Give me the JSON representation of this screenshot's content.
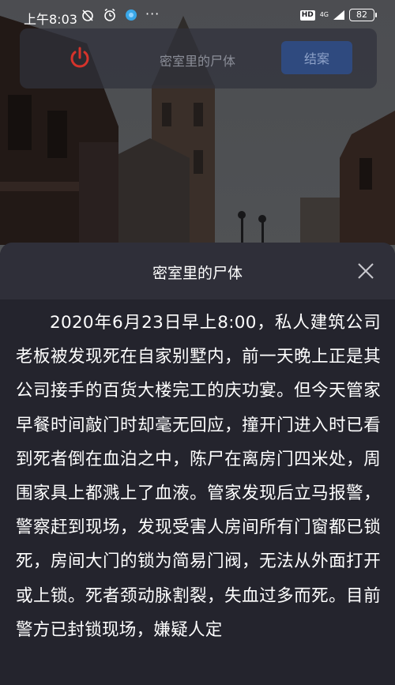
{
  "status_bar": {
    "time": "上午8:03",
    "hd": "HD",
    "network": "4G",
    "battery": "82"
  },
  "top_bar": {
    "title": "密室里的尸体",
    "close_case_label": "结案"
  },
  "sheet": {
    "title": "密室里的尸体",
    "story": "2020年6月23日早上8:00，私人建筑公司老板被发现死在自家别墅内，前一天晚上正是其公司接手的百货大楼完工的庆功宴。但今天管家早餐时间敲门时却毫无回应，撞开门进入时已看到死者倒在血泊之中，陈尸在离房门四米处，周围家具上都溅上了血液。管家发现后立马报警，警察赶到现场，发现受害人房间所有门窗都已锁死，房间大门的锁为简易门阀，无法从外面打开或上锁。死者颈动脉割裂，失血过多而死。目前警方已封锁现场，嫌疑人定"
  },
  "colors": {
    "power_icon": "#d6332b",
    "close_case_button": "#2f4a7f",
    "sheet_bg": "#24242d",
    "sheet_header_bg": "#2f2f39"
  },
  "icons": [
    "alarm-off-icon",
    "alarm-clock-icon",
    "app-dot-icon",
    "power-icon",
    "close-icon"
  ]
}
